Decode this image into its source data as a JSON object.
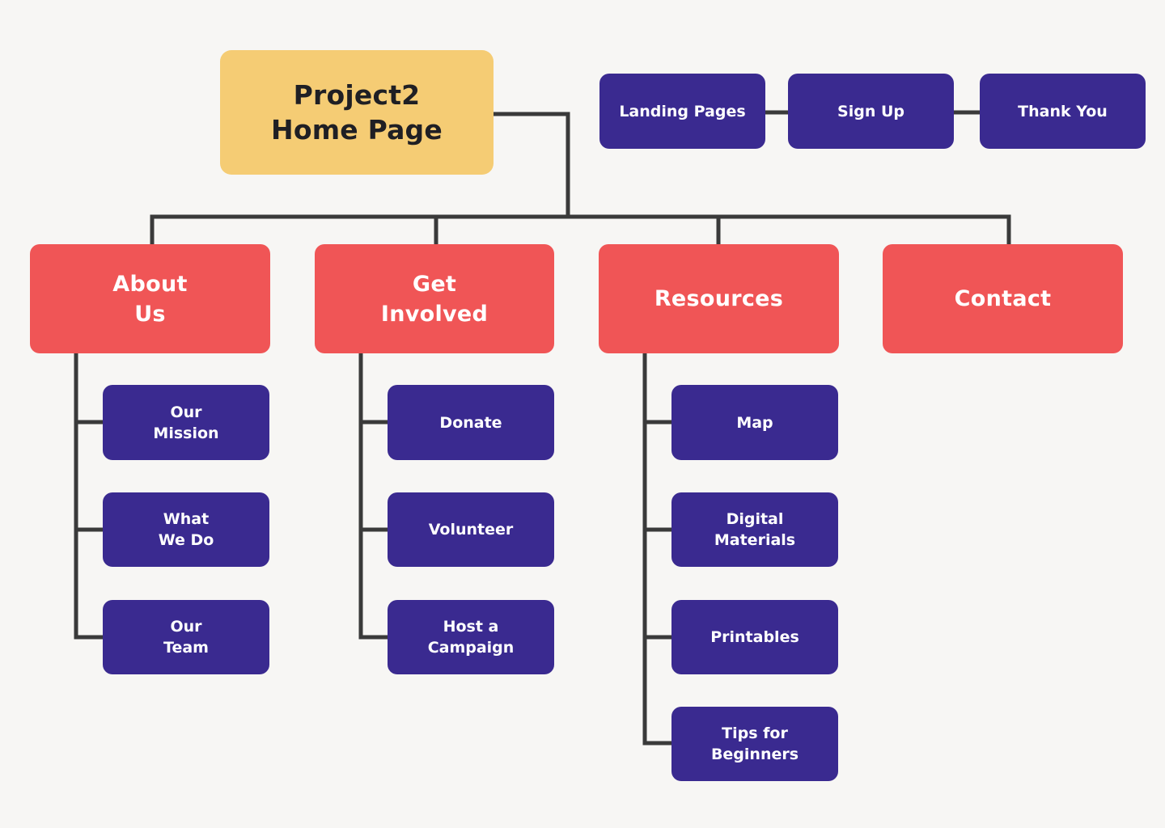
{
  "diagram": {
    "type": "sitemap",
    "colors": {
      "background": "#f7f6f4",
      "root": "#f5cc74",
      "section": "#f05556",
      "page": "#3a2a90",
      "connector": "#3a3a3a",
      "root_text": "#1f1f24",
      "node_text": "#ffffff"
    },
    "root": {
      "id": "home",
      "label": "Project2\nHome Page"
    },
    "flow": [
      {
        "id": "landing",
        "label": "Landing Pages"
      },
      {
        "id": "signup",
        "label": "Sign Up"
      },
      {
        "id": "thankyou",
        "label": "Thank You"
      }
    ],
    "sections": [
      {
        "id": "about",
        "label": "About\nUs",
        "children": [
          {
            "id": "mission",
            "label": "Our\nMission"
          },
          {
            "id": "whatwedo",
            "label": "What\nWe Do"
          },
          {
            "id": "team",
            "label": "Our\nTeam"
          }
        ]
      },
      {
        "id": "involved",
        "label": "Get\nInvolved",
        "children": [
          {
            "id": "donate",
            "label": "Donate"
          },
          {
            "id": "volunteer",
            "label": "Volunteer"
          },
          {
            "id": "campaign",
            "label": "Host a\nCampaign"
          }
        ]
      },
      {
        "id": "resources",
        "label": "Resources",
        "children": [
          {
            "id": "map",
            "label": "Map"
          },
          {
            "id": "digital",
            "label": "Digital\nMaterials"
          },
          {
            "id": "printables",
            "label": "Printables"
          },
          {
            "id": "tips",
            "label": "Tips for\nBeginners"
          }
        ]
      },
      {
        "id": "contact",
        "label": "Contact",
        "children": []
      }
    ],
    "edges": [
      [
        "home",
        "about"
      ],
      [
        "home",
        "involved"
      ],
      [
        "home",
        "resources"
      ],
      [
        "home",
        "contact"
      ],
      [
        "landing",
        "signup"
      ],
      [
        "signup",
        "thankyou"
      ],
      [
        "about",
        "mission"
      ],
      [
        "about",
        "whatwedo"
      ],
      [
        "about",
        "team"
      ],
      [
        "involved",
        "donate"
      ],
      [
        "involved",
        "volunteer"
      ],
      [
        "involved",
        "campaign"
      ],
      [
        "resources",
        "map"
      ],
      [
        "resources",
        "digital"
      ],
      [
        "resources",
        "printables"
      ],
      [
        "resources",
        "tips"
      ]
    ]
  }
}
